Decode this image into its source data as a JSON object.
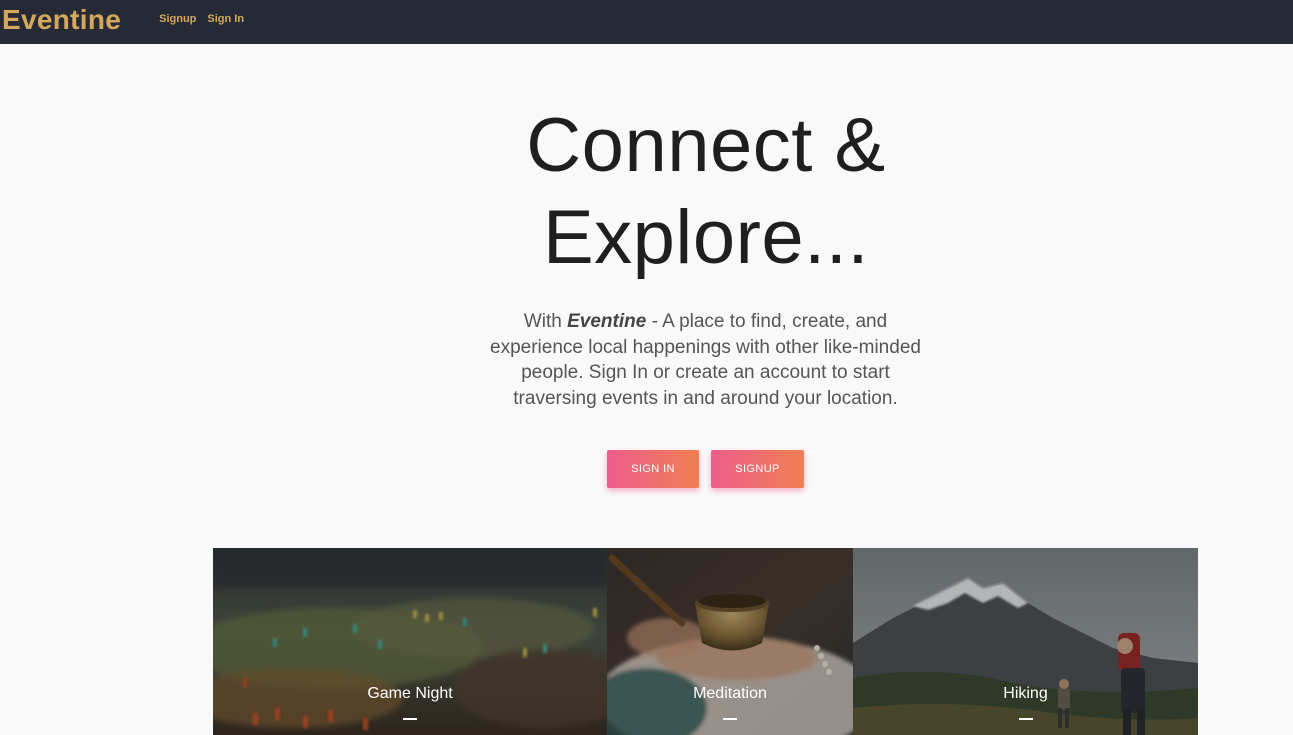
{
  "navbar": {
    "brand": "Eventine",
    "links": [
      "Signup",
      "Sign In"
    ]
  },
  "hero": {
    "title_line1": "Connect &",
    "title_line2": "Explore...",
    "desc_prefix": "With ",
    "desc_brand": "Eventine",
    "desc_rest": " - A place to find, create, and experience local happenings with other like-minded people. Sign In or create an account to start traversing events in and around your location.",
    "buttons": {
      "sign_in": "SIGN IN",
      "signup": "SIGNUP"
    }
  },
  "categories": [
    {
      "label": "Game Night",
      "icon": "board-game-image"
    },
    {
      "label": "Meditation",
      "icon": "singing-bowl-image"
    },
    {
      "label": "Hiking",
      "icon": "mountain-hikers-image"
    }
  ],
  "colors": {
    "navbar_bg": "#262a36",
    "brand": "#d4a85c",
    "button_gradient_start": "#ee5d8b",
    "button_gradient_end": "#f07f52",
    "page_bg": "#f9f9f9"
  }
}
